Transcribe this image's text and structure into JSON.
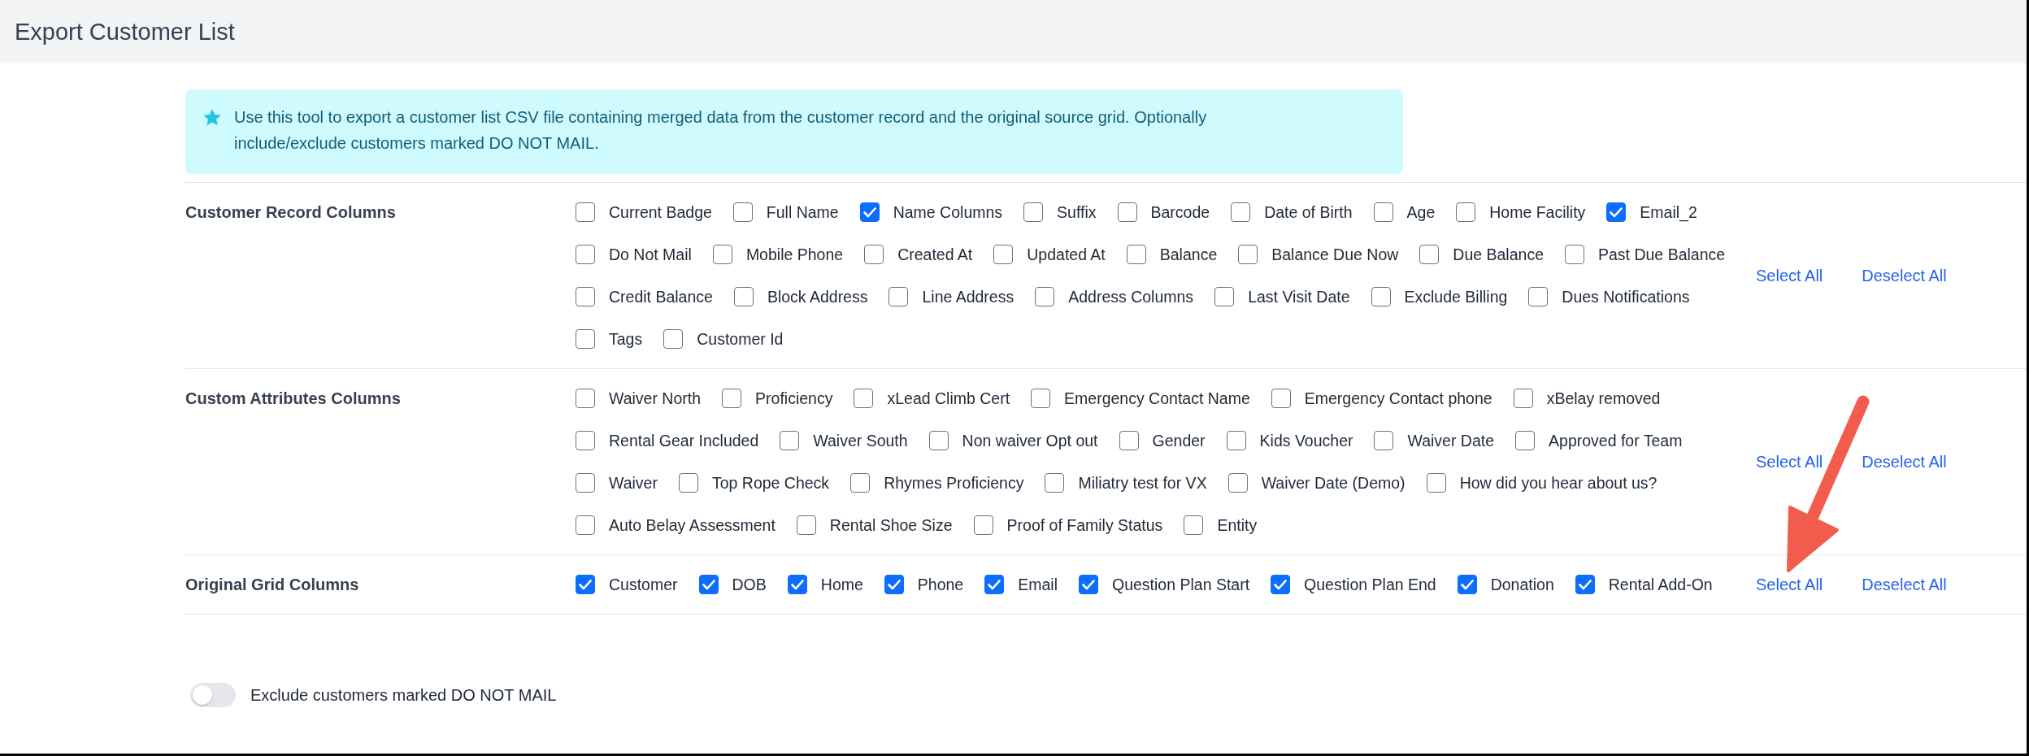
{
  "window": {
    "title": "Export Customer List"
  },
  "info": {
    "text": "Use this tool to export a customer list CSV file containing merged data from the customer record and the original source grid. Optionally include/exclude customers marked DO NOT MAIL."
  },
  "sections": [
    {
      "label": "Customer Record Columns",
      "select_all": "Select All",
      "deselect_all": "Deselect All",
      "option_rows": [
        [
          {
            "label": "Current Badge",
            "checked": false
          },
          {
            "label": "Full Name",
            "checked": false
          },
          {
            "label": "Name Columns",
            "checked": true
          },
          {
            "label": "Suffix",
            "checked": false
          },
          {
            "label": "Barcode",
            "checked": false
          },
          {
            "label": "Date of Birth",
            "checked": false
          },
          {
            "label": "Age",
            "checked": false
          },
          {
            "label": "Home Facility",
            "checked": false
          },
          {
            "label": "Email_2",
            "checked": true
          }
        ],
        [
          {
            "label": "Do Not Mail",
            "checked": false
          },
          {
            "label": "Mobile Phone",
            "checked": false
          },
          {
            "label": "Created At",
            "checked": false
          },
          {
            "label": "Updated At",
            "checked": false
          },
          {
            "label": "Balance",
            "checked": false
          },
          {
            "label": "Balance Due Now",
            "checked": false
          },
          {
            "label": "Due Balance",
            "checked": false
          },
          {
            "label": "Past Due Balance",
            "checked": false
          }
        ],
        [
          {
            "label": "Credit Balance",
            "checked": false
          },
          {
            "label": "Block Address",
            "checked": false
          },
          {
            "label": "Line Address",
            "checked": false
          },
          {
            "label": "Address Columns",
            "checked": false
          },
          {
            "label": "Last Visit Date",
            "checked": false
          },
          {
            "label": "Exclude Billing",
            "checked": false
          },
          {
            "label": "Dues Notifications",
            "checked": false
          }
        ],
        [
          {
            "label": "Tags",
            "checked": false
          },
          {
            "label": "Customer Id",
            "checked": false
          }
        ]
      ]
    },
    {
      "label": "Custom Attributes Columns",
      "select_all": "Select All",
      "deselect_all": "Deselect All",
      "option_rows": [
        [
          {
            "label": "Waiver North",
            "checked": false
          },
          {
            "label": "Proficiency",
            "checked": false
          },
          {
            "label": "xLead Climb Cert",
            "checked": false
          },
          {
            "label": "Emergency Contact Name",
            "checked": false
          },
          {
            "label": "Emergency Contact phone",
            "checked": false
          },
          {
            "label": "xBelay removed",
            "checked": false
          }
        ],
        [
          {
            "label": "Rental Gear Included",
            "checked": false
          },
          {
            "label": "Waiver South",
            "checked": false
          },
          {
            "label": "Non waiver Opt out",
            "checked": false
          },
          {
            "label": "Gender",
            "checked": false
          },
          {
            "label": "Kids Voucher",
            "checked": false
          },
          {
            "label": "Waiver Date",
            "checked": false
          },
          {
            "label": "Approved for Team",
            "checked": false
          }
        ],
        [
          {
            "label": "Waiver",
            "checked": false
          },
          {
            "label": "Top Rope Check",
            "checked": false
          },
          {
            "label": "Rhymes Proficiency",
            "checked": false
          },
          {
            "label": "Miliatry test for VX",
            "checked": false
          },
          {
            "label": "Waiver Date (Demo)",
            "checked": false
          },
          {
            "label": "How did you hear about us?",
            "checked": false
          }
        ],
        [
          {
            "label": "Auto Belay Assessment",
            "checked": false
          },
          {
            "label": "Rental Shoe Size",
            "checked": false
          },
          {
            "label": "Proof of Family Status",
            "checked": false
          },
          {
            "label": "Entity",
            "checked": false
          }
        ]
      ]
    },
    {
      "label": "Original Grid Columns",
      "select_all": "Select All",
      "deselect_all": "Deselect All",
      "option_rows": [
        [
          {
            "label": "Customer",
            "checked": true
          },
          {
            "label": "DOB",
            "checked": true
          },
          {
            "label": "Home",
            "checked": true
          },
          {
            "label": "Phone",
            "checked": true
          },
          {
            "label": "Email",
            "checked": true
          },
          {
            "label": "Question Plan Start",
            "checked": true
          },
          {
            "label": "Question Plan End",
            "checked": true
          },
          {
            "label": "Donation",
            "checked": true
          },
          {
            "label": "Rental Add-On",
            "checked": true
          }
        ]
      ]
    }
  ],
  "exclude_toggle": {
    "label": "Exclude customers marked DO NOT MAIL",
    "on": false
  },
  "annotations": [
    {
      "kind": "arrow"
    }
  ]
}
